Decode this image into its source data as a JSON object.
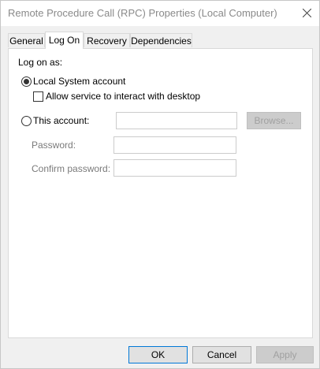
{
  "window": {
    "title": "Remote Procedure Call (RPC) Properties (Local Computer)"
  },
  "tabs": [
    {
      "label": "General"
    },
    {
      "label": "Log On"
    },
    {
      "label": "Recovery"
    },
    {
      "label": "Dependencies"
    }
  ],
  "logon": {
    "heading": "Log on as:",
    "local_system_label": "Local System account",
    "local_system_selected": true,
    "interact_desktop_label": "Allow service to interact with desktop",
    "interact_desktop_checked": false,
    "this_account_label": "This account:",
    "this_account_selected": false,
    "account_value": "",
    "browse_label": "Browse...",
    "password_label": "Password:",
    "password_value": "",
    "confirm_password_label": "Confirm password:",
    "confirm_password_value": ""
  },
  "footer": {
    "ok_label": "OK",
    "cancel_label": "Cancel",
    "apply_label": "Apply"
  }
}
